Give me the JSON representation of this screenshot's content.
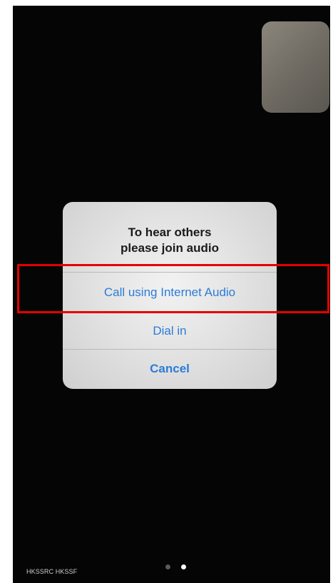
{
  "dialog": {
    "title_line1": "To hear others",
    "title_line2": "please join audio",
    "actions": [
      {
        "label": "Call using Internet Audio",
        "highlighted": true
      },
      {
        "label": "Dial in",
        "highlighted": false
      },
      {
        "label": "Cancel",
        "highlighted": false
      }
    ]
  },
  "page_indicator": {
    "total_pages": 2,
    "current_page": 2
  },
  "watermark": {
    "text": "HKSSRC HKSSF"
  },
  "colors": {
    "background": "#050505",
    "dialog_background": "#e6e6e6",
    "action_text": "#2b7cd8",
    "highlight_border": "#e50000",
    "dot_active": "#ffffff",
    "dot_inactive": "#5a5a5a"
  }
}
